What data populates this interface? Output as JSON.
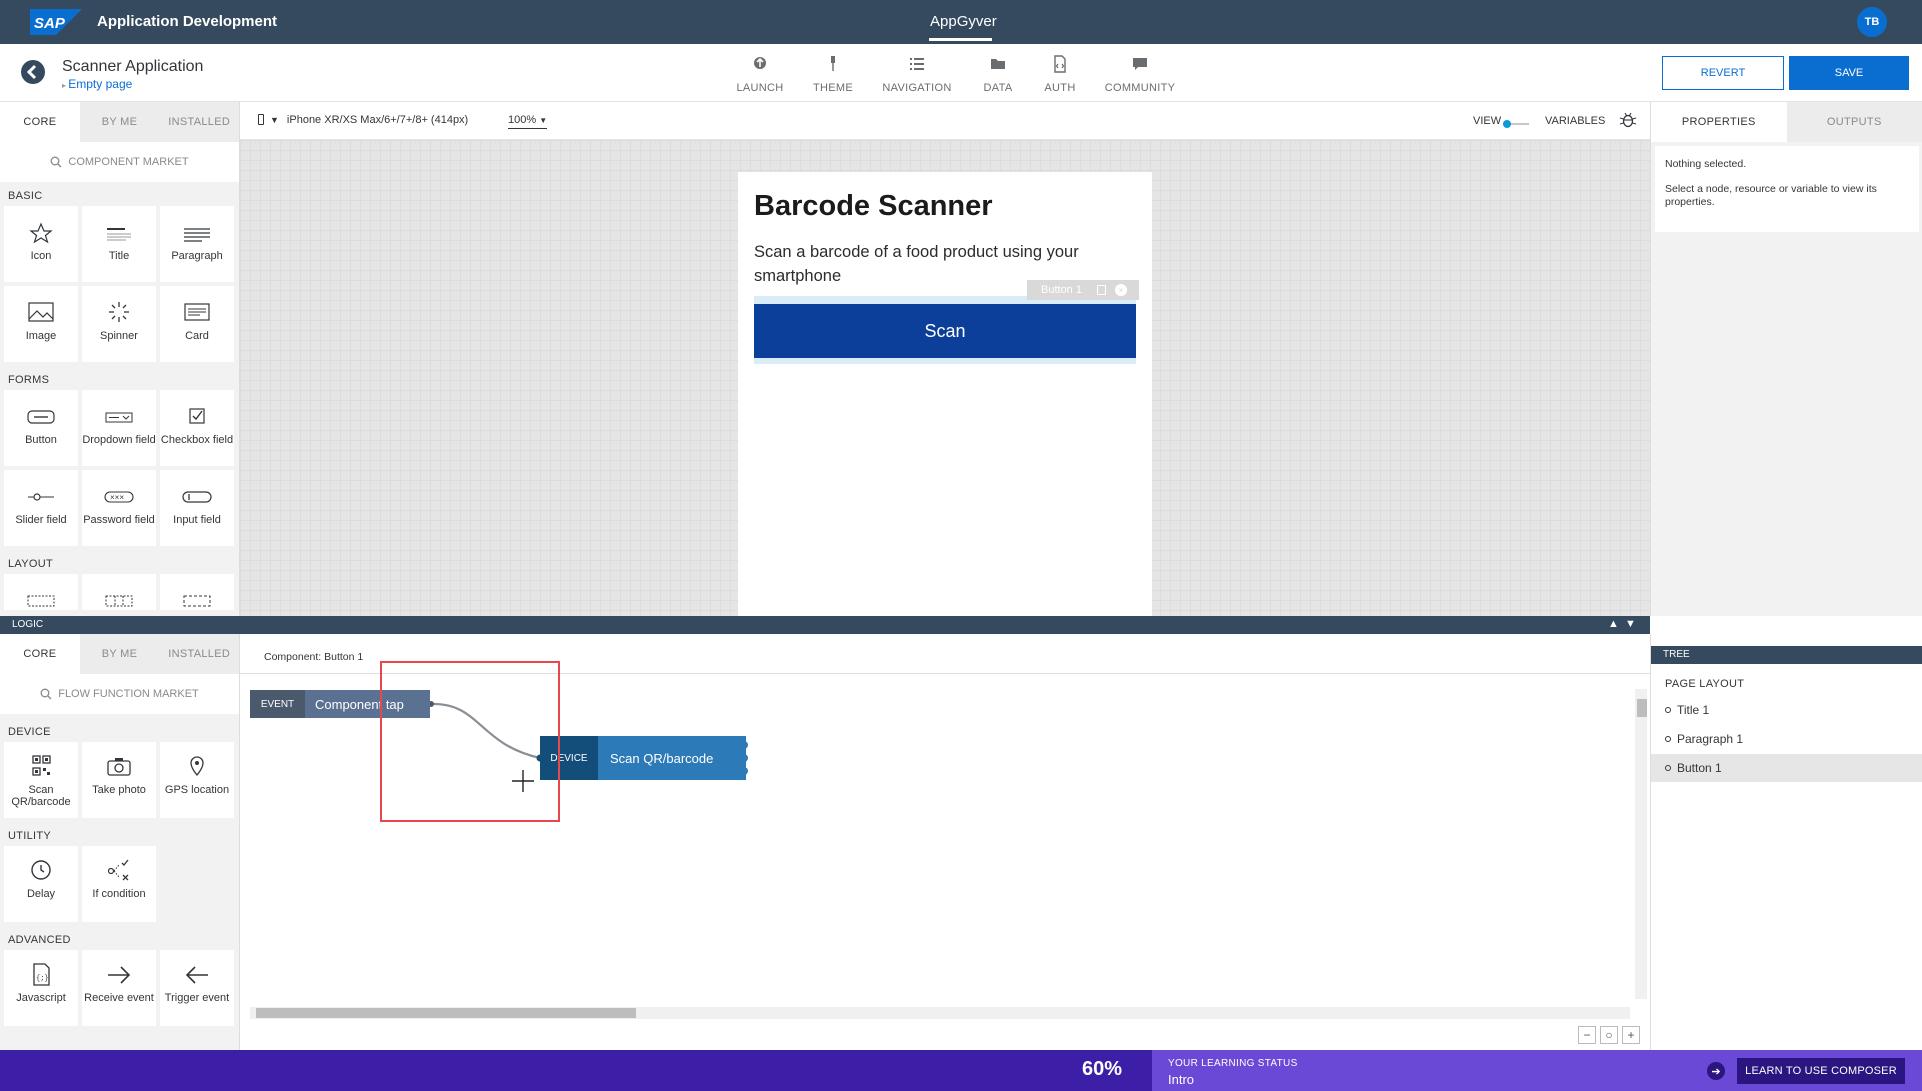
{
  "shell": {
    "logo": "SAP",
    "app_title": "Application Development",
    "product": "AppGyver",
    "user_initials": "TB"
  },
  "header": {
    "project_name": "Scanner Application",
    "page_selector": "Empty page",
    "nav": [
      {
        "label": "LAUNCH",
        "icon": "rocket-icon"
      },
      {
        "label": "THEME",
        "icon": "brush-icon"
      },
      {
        "label": "NAVIGATION",
        "icon": "list-icon"
      },
      {
        "label": "DATA",
        "icon": "folder-icon"
      },
      {
        "label": "AUTH",
        "icon": "code-file-icon"
      },
      {
        "label": "COMMUNITY",
        "icon": "chat-icon"
      }
    ],
    "revert_label": "REVERT",
    "save_label": "SAVE"
  },
  "left_panel": {
    "tabs": [
      "CORE",
      "BY ME",
      "INSTALLED"
    ],
    "search_placeholder": "COMPONENT MARKET",
    "sections": {
      "basic": "BASIC",
      "forms": "FORMS",
      "layout": "LAYOUT"
    },
    "basic_tiles": [
      "Icon",
      "Title",
      "Paragraph",
      "Image",
      "Spinner",
      "Card"
    ],
    "forms_tiles": [
      "Button",
      "Dropdown field",
      "Checkbox field",
      "Slider field",
      "Password field",
      "Input field"
    ]
  },
  "canvas_toolbar": {
    "device": "iPhone XR/XS Max/6+/7+/8+ (414px)",
    "zoom": "100%",
    "view_label": "VIEW",
    "variables_label": "VARIABLES"
  },
  "phone": {
    "title": "Barcode Scanner",
    "paragraph": "Scan a barcode of a food product using your smartphone",
    "button_tag": "Button 1",
    "button_label": "Scan"
  },
  "right_panel": {
    "tabs": [
      "PROPERTIES",
      "OUTPUTS"
    ],
    "nothing_selected": "Nothing selected.",
    "hint": "Select a node, resource or variable to view its properties."
  },
  "logic": {
    "bar_label": "LOGIC",
    "tabs": [
      "CORE",
      "BY ME",
      "INSTALLED"
    ],
    "search_placeholder": "FLOW FUNCTION MARKET",
    "component_label": "Component: Button 1",
    "sections": {
      "device": "DEVICE",
      "utility": "UTILITY",
      "advanced": "ADVANCED"
    },
    "device_tiles": [
      "Scan QR/barcode",
      "Take photo",
      "GPS location"
    ],
    "utility_tiles": [
      "Delay",
      "If condition"
    ],
    "advanced_tiles": [
      "Javascript",
      "Receive event",
      "Trigger event"
    ],
    "event_node": {
      "tag": "EVENT",
      "label": "Component tap"
    },
    "device_node": {
      "tag": "DEVICE",
      "label": "Scan QR/barcode"
    }
  },
  "tree": {
    "bar_label": "TREE",
    "title": "PAGE LAYOUT",
    "items": [
      "Title 1",
      "Paragraph 1",
      "Button 1"
    ],
    "selected": "Button 1"
  },
  "bottom": {
    "progress": "60%",
    "status_label": "YOUR LEARNING STATUS",
    "status_value": "Intro",
    "learn_button": "LEARN TO USE COMPOSER"
  },
  "colors": {
    "shell": "#354a5f",
    "primary": "#0a6ed1",
    "scan_button": "#0c3f99",
    "bottom_bar": "#3c1fa6",
    "highlight": "#e5484d"
  }
}
